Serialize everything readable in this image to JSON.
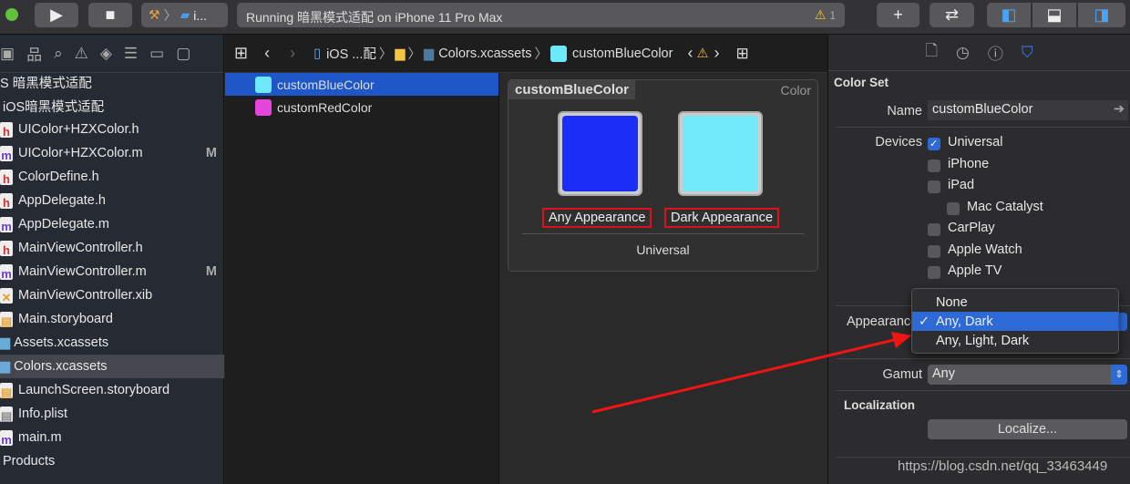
{
  "toolbar": {
    "scheme": "i...",
    "status": "Running 暗黑模式适配 on iPhone 11 Pro Max",
    "warning_count": "1"
  },
  "navigator": {
    "items": [
      {
        "label": "S 暗黑模式适配",
        "type": "project"
      },
      {
        "label": "iOS暗黑模式适配",
        "type": "group"
      },
      {
        "label": "UIColor+HZXColor.h",
        "type": "h"
      },
      {
        "label": "UIColor+HZXColor.m",
        "type": "m",
        "flag": "M"
      },
      {
        "label": "ColorDefine.h",
        "type": "h"
      },
      {
        "label": "AppDelegate.h",
        "type": "h"
      },
      {
        "label": "AppDelegate.m",
        "type": "m"
      },
      {
        "label": "MainViewController.h",
        "type": "h"
      },
      {
        "label": "MainViewController.m",
        "type": "m",
        "flag": "M"
      },
      {
        "label": "MainViewController.xib",
        "type": "x"
      },
      {
        "label": "Main.storyboard",
        "type": "sb"
      },
      {
        "label": "Assets.xcassets",
        "type": "folder"
      },
      {
        "label": "Colors.xcassets",
        "type": "folder",
        "selected": true
      },
      {
        "label": "LaunchScreen.storyboard",
        "type": "sb"
      },
      {
        "label": "Info.plist",
        "type": "plist"
      },
      {
        "label": "main.m",
        "type": "m"
      },
      {
        "label": "Products",
        "type": "group"
      }
    ]
  },
  "jumpbar": {
    "project": "iOS ...配",
    "folder": "Colors.xcassets",
    "item": "customBlueColor"
  },
  "assets": [
    {
      "label": "customBlueColor",
      "color": "#6ee9fb",
      "selected": true
    },
    {
      "label": "customRedColor",
      "color": "#e545dc"
    }
  ],
  "editor": {
    "title": "customBlueColor",
    "kind": "Color",
    "any_label": "Any Appearance",
    "dark_label": "Dark Appearance",
    "any_color": "#1b2ef5",
    "dark_color": "#70eafb",
    "group_label": "Universal"
  },
  "inspector": {
    "section": "Color Set",
    "name_label": "Name",
    "name_value": "customBlueColor",
    "devices_label": "Devices",
    "devices": [
      {
        "label": "Universal",
        "checked": true
      },
      {
        "label": "iPhone"
      },
      {
        "label": "iPad"
      },
      {
        "label": "Mac Catalyst",
        "indent": true
      },
      {
        "label": "CarPlay"
      },
      {
        "label": "Apple Watch"
      },
      {
        "label": "Apple TV"
      }
    ],
    "appearance_label": "Appearance",
    "gamut_label": "Gamut",
    "gamut_value": "Any",
    "localization": "Localization",
    "localize_button": "Localize..."
  },
  "menu": {
    "options": [
      "None",
      "Any, Dark",
      "Any, Light, Dark"
    ],
    "selected": 1
  },
  "watermark": "https://blog.csdn.net/qq_33463449"
}
